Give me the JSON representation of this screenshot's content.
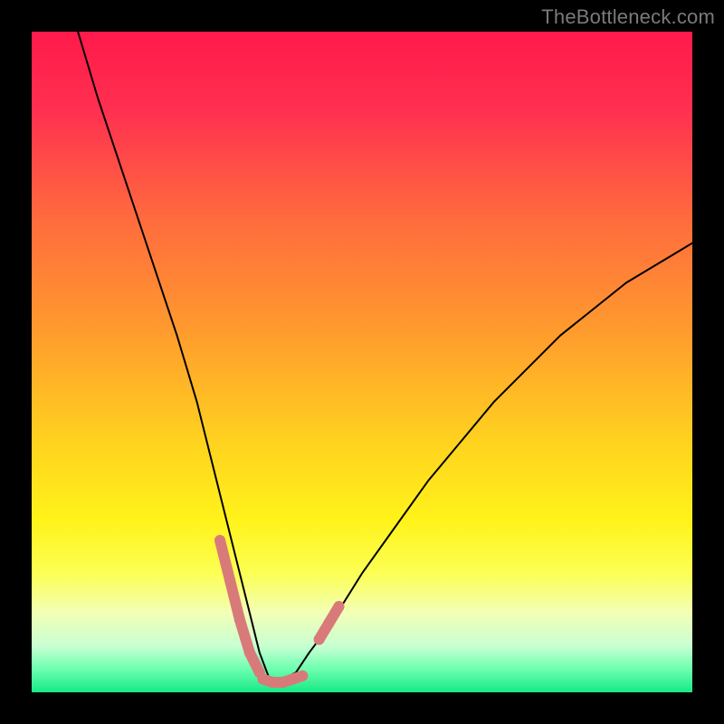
{
  "watermark": "TheBottleneck.com",
  "chart_data": {
    "type": "line",
    "title": "",
    "xlabel": "",
    "ylabel": "",
    "xlim": [
      0,
      100
    ],
    "ylim": [
      0,
      100
    ],
    "series": [
      {
        "name": "bottleneck-curve",
        "x": [
          7,
          10,
          14,
          18,
          22,
          25,
          27,
          29,
          31,
          33,
          34.5,
          36,
          38,
          40,
          42,
          45,
          50,
          55,
          60,
          65,
          70,
          75,
          80,
          85,
          90,
          95,
          100
        ],
        "values": [
          100,
          90,
          78,
          66,
          54,
          44,
          36,
          28,
          20,
          12,
          6,
          2,
          2,
          3,
          6,
          10,
          18,
          25,
          32,
          38,
          44,
          49,
          54,
          58,
          62,
          65,
          68
        ]
      }
    ],
    "highlight_segments": [
      {
        "name": "left-marker",
        "x": [
          28.5,
          30.0,
          31.5,
          33.0,
          34.5
        ],
        "values": [
          23,
          17,
          11,
          6,
          3
        ]
      },
      {
        "name": "bottom-marker",
        "x": [
          35,
          36.5,
          38,
          39.5,
          41
        ],
        "values": [
          2,
          1.5,
          1.5,
          2,
          2.5
        ]
      },
      {
        "name": "right-marker",
        "x": [
          43.5,
          45,
          46.5
        ],
        "values": [
          8,
          10.5,
          13
        ]
      }
    ],
    "gradient_stops": [
      {
        "offset": 0.0,
        "color": "#ff1a4b"
      },
      {
        "offset": 0.12,
        "color": "#ff3050"
      },
      {
        "offset": 0.28,
        "color": "#ff6a3e"
      },
      {
        "offset": 0.45,
        "color": "#ff9a2e"
      },
      {
        "offset": 0.62,
        "color": "#ffd21f"
      },
      {
        "offset": 0.74,
        "color": "#fff31a"
      },
      {
        "offset": 0.82,
        "color": "#fcff55"
      },
      {
        "offset": 0.88,
        "color": "#f2ffb6"
      },
      {
        "offset": 0.93,
        "color": "#c8ffd2"
      },
      {
        "offset": 0.965,
        "color": "#6cffb0"
      },
      {
        "offset": 1.0,
        "color": "#17e885"
      }
    ],
    "curve_style": {
      "stroke": "#000000",
      "width_main": 2,
      "width_thick": 12,
      "highlight_color": "#d97a7a"
    }
  }
}
